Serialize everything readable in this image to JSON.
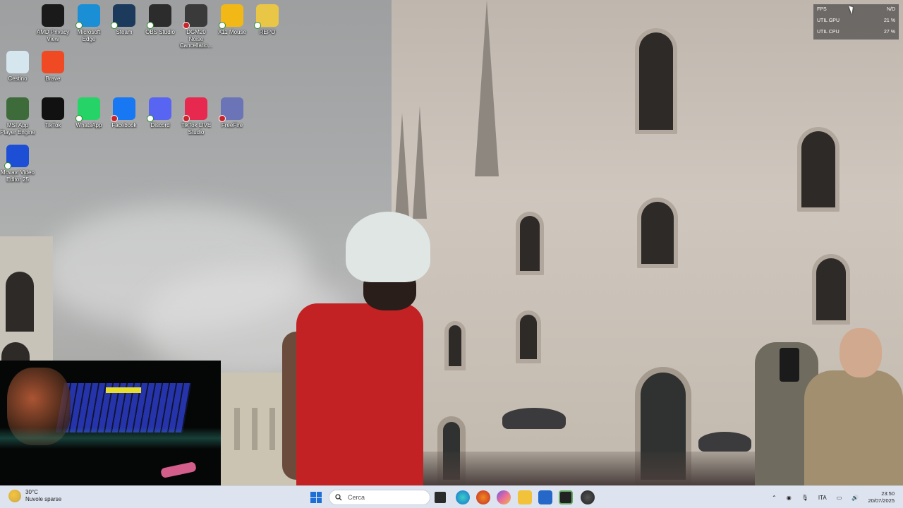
{
  "desktop": {
    "icons": [
      {
        "label": "AMD Privacy View",
        "icon": "amd-privacy-view-icon",
        "color": "#1a1a1a"
      },
      {
        "label": "Microsoft Edge",
        "icon": "edge-icon",
        "color": "#1a8fd6"
      },
      {
        "label": "Steam",
        "icon": "steam-icon",
        "color": "#1b3a5c"
      },
      {
        "label": "OBS Studio",
        "icon": "obs-icon",
        "color": "#2c2c2c"
      },
      {
        "label": "DGM20 Noise Cancellatio...",
        "icon": "dgm20-icon",
        "color": "#3a3a3a"
      },
      {
        "label": "X11 Mouse",
        "icon": "x11-mouse-icon",
        "color": "#f2b816"
      },
      {
        "label": "REPO",
        "icon": "repo-icon",
        "color": "#e9c646"
      },
      {
        "label": "Cestino",
        "icon": "recycle-bin-icon",
        "color": "#d6e6ee"
      },
      {
        "label": "Brave",
        "icon": "brave-icon",
        "color": "#f04a24"
      },
      {
        "label": "MSI App Player Engine",
        "icon": "msi-app-player-icon",
        "color": "#3d6b3a"
      },
      {
        "label": "TikTok",
        "icon": "tiktok-icon",
        "color": "#111111"
      },
      {
        "label": "WhatsApp",
        "icon": "whatsapp-icon",
        "color": "#25d366"
      },
      {
        "label": "Facebook",
        "icon": "facebook-icon",
        "color": "#1877f2"
      },
      {
        "label": "Discord",
        "icon": "discord-icon",
        "color": "#5865f2"
      },
      {
        "label": "TikTok LIVE Studio",
        "icon": "tiktok-live-studio-icon",
        "color": "#e8294f"
      },
      {
        "label": "FreeFire",
        "icon": "freefire-icon",
        "color": "#6a74b6"
      },
      {
        "label": "Movavi Video Editor 25",
        "icon": "movavi-icon",
        "color": "#1c4fd6"
      }
    ]
  },
  "perf_overlay": {
    "rows": [
      {
        "label": "FPS",
        "value": "N/D"
      },
      {
        "label": "UTIL GPU",
        "value": "21 %"
      },
      {
        "label": "UTIL CPU",
        "value": "27 %"
      }
    ]
  },
  "taskbar": {
    "weather_temp": "30°C",
    "weather_desc": "Nuvole sparse",
    "search_placeholder": "Cerca",
    "language": "ITA",
    "time": "23:50",
    "date": "20/07/2025"
  }
}
